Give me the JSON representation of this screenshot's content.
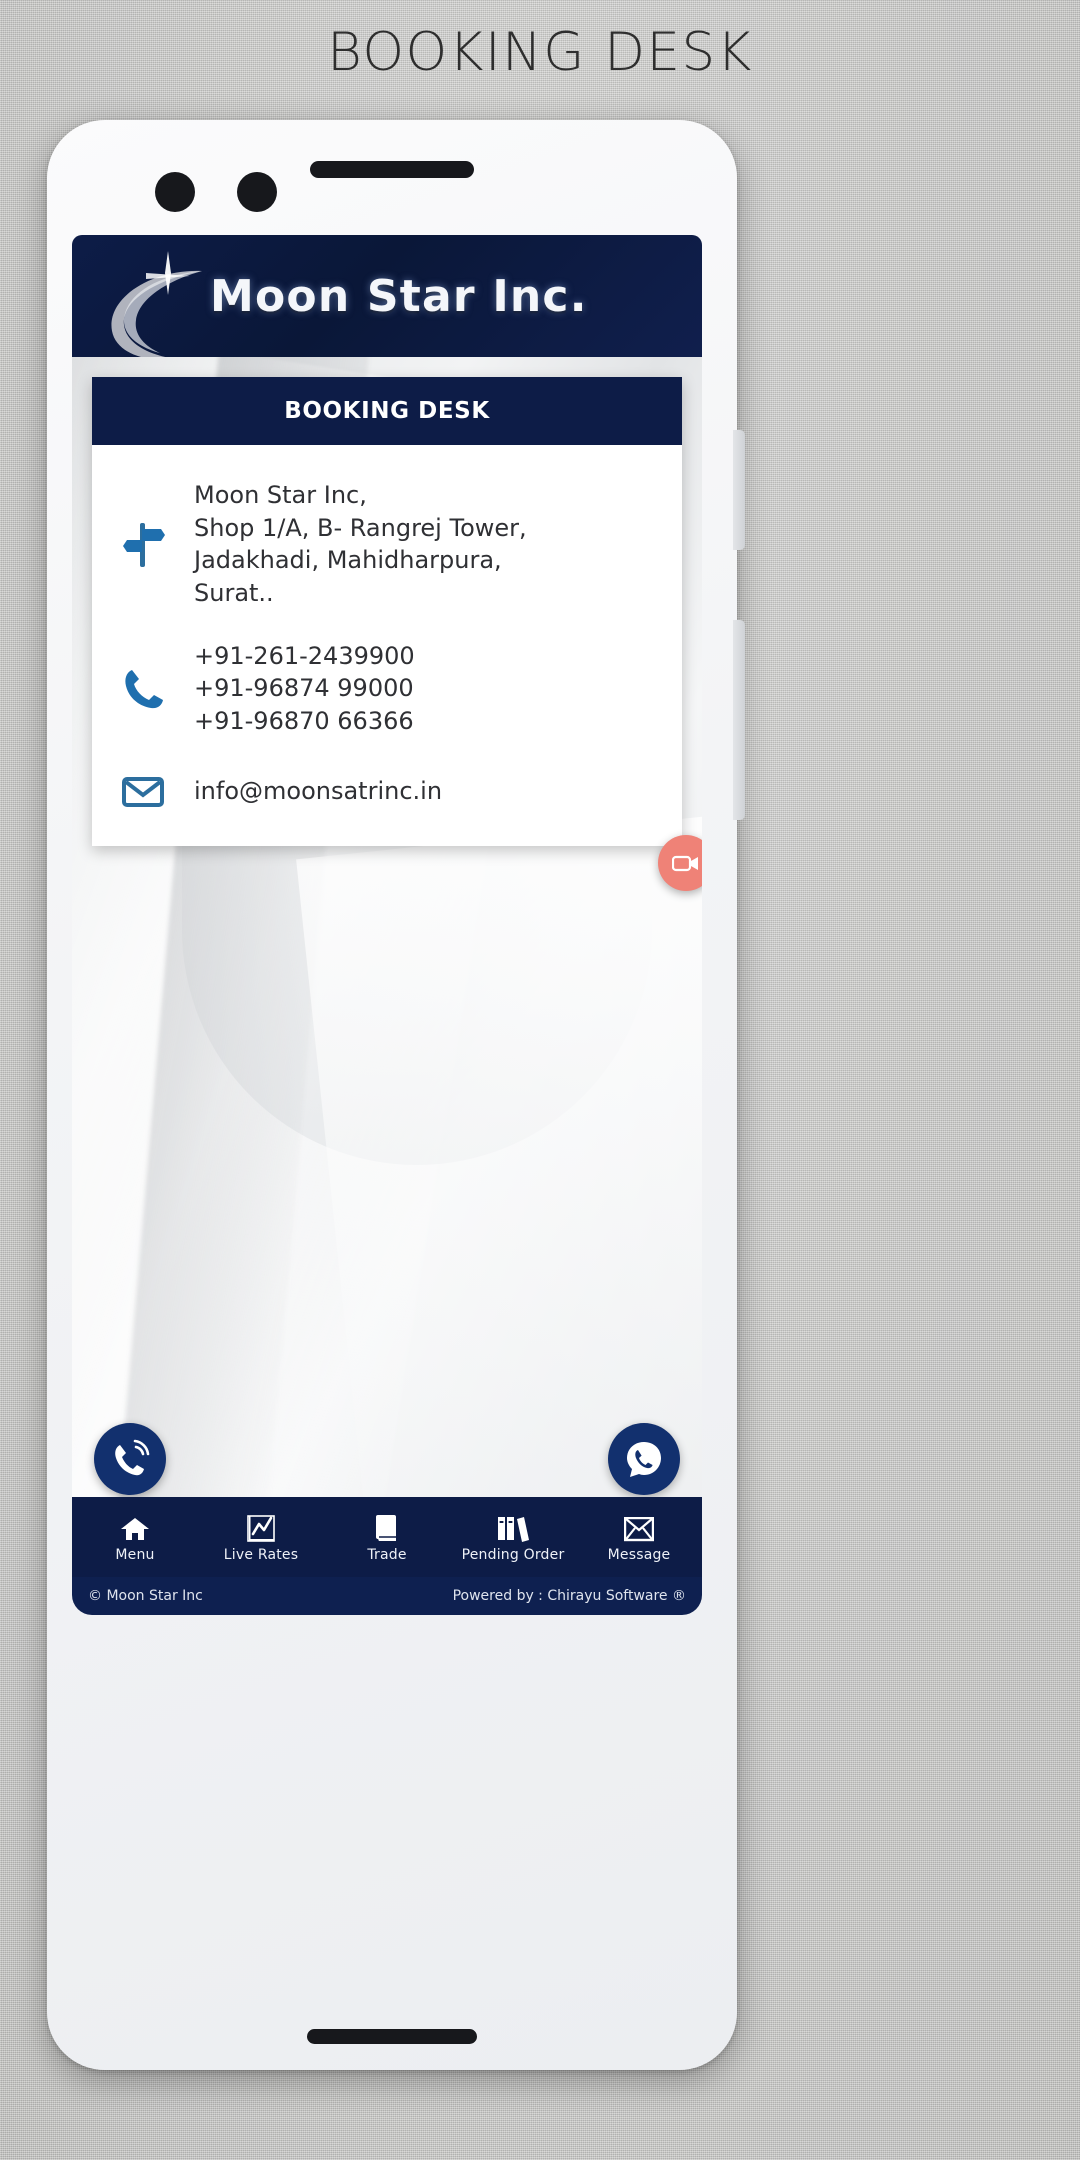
{
  "page": {
    "title": "BOOKING DESK"
  },
  "brand": {
    "name": "Moon Star Inc.",
    "navy": "#0d1c47",
    "accent_blue": "#1a6aa8"
  },
  "card": {
    "title": "BOOKING DESK",
    "address": {
      "icon": "signpost-icon",
      "lines": [
        "Moon Star Inc,",
        "Shop 1/A, B- Rangrej Tower,",
        "Jadakhadi, Mahidharpura,",
        "Surat.."
      ]
    },
    "phone": {
      "icon": "phone-icon",
      "lines": [
        "+91-261-2439900",
        "+91-96874 99000",
        "+91-96870 66366"
      ]
    },
    "email": {
      "icon": "envelope-icon",
      "lines": [
        "info@moonsatrinc.in"
      ]
    }
  },
  "fabs": [
    {
      "name": "video-support-fab",
      "icon": "video-camera-icon",
      "color": "#ef8277"
    },
    {
      "name": "callback-fab",
      "icon": "phone-signal-icon",
      "color": "#12306e"
    },
    {
      "name": "whatsapp-fab",
      "icon": "phone-chat-icon",
      "color": "#12306e"
    }
  ],
  "bottom_nav": [
    {
      "label": "Menu",
      "icon": "home-icon"
    },
    {
      "label": "Live Rates",
      "icon": "line-chart-icon"
    },
    {
      "label": "Trade",
      "icon": "book-icon"
    },
    {
      "label": "Pending Order",
      "icon": "books-icon"
    },
    {
      "label": "Message",
      "icon": "envelope-icon"
    }
  ],
  "footer": {
    "copyright": "© Moon Star Inc",
    "powered_by": "Powered by : Chirayu Software ®"
  }
}
